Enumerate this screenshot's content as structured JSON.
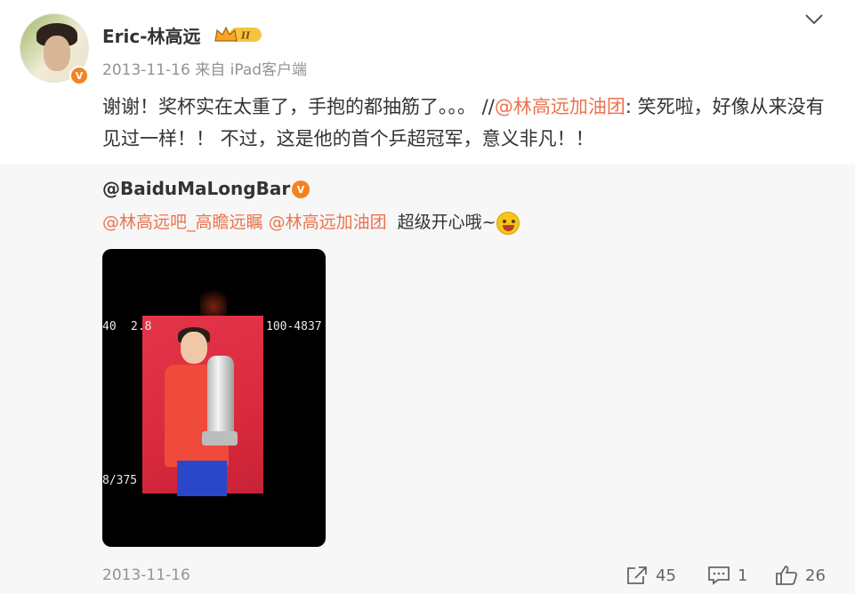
{
  "post": {
    "username": "Eric-林高远",
    "level_badge": "II",
    "verify_badge": "V",
    "date": "2013-11-16",
    "source": "来自 iPad客户端",
    "text_before": "谢谢！奖杯实在太重了，手抱的都抽筋了。。。 //",
    "mention": "@林高远加油团",
    "text_after": ": 笑死啦，好像从来没有见过一样！！ 不过，这是他的首个乒超冠军，意义非凡！！"
  },
  "repost": {
    "username": "@BaiduMaLongBar",
    "verify_badge": "V",
    "mention1": "@林高远吧_高瞻远瞩",
    "mention2": "@林高远加油团",
    "text": "超级开心哦~",
    "emoji": "laughing-emoji",
    "photo": {
      "screen_left_top": "40",
      "screen_mid_top": "2.8",
      "screen_right_top": "100-4837",
      "screen_left_bottom": "8/375"
    },
    "date": "2013-11-16",
    "actions": {
      "share_count": "45",
      "comment_count": "1",
      "like_count": "26"
    }
  },
  "colors": {
    "mention": "#eb7350",
    "verify": "#f58220",
    "repost_bg": "#f7f7f7",
    "meta": "#939393"
  },
  "icons": [
    "chevron-down-icon",
    "share-icon",
    "comment-icon",
    "like-icon"
  ]
}
